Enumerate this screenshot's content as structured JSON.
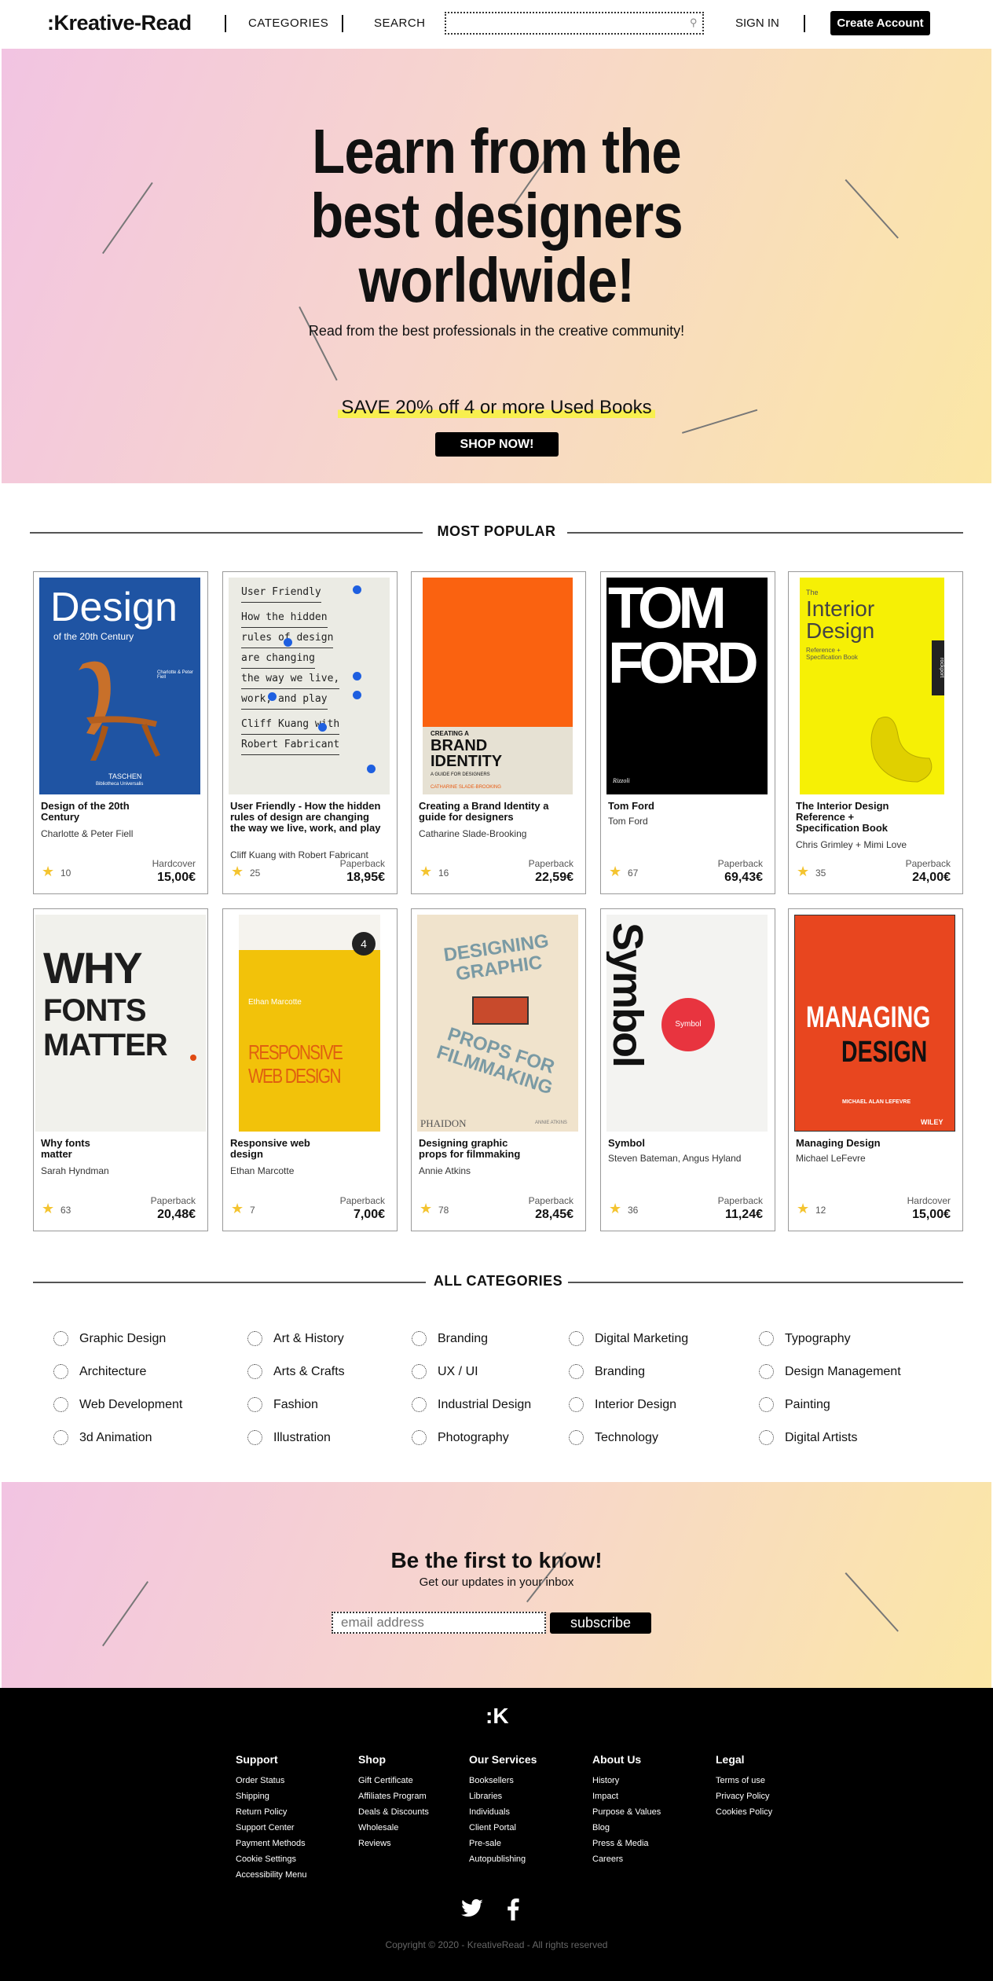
{
  "header": {
    "logo": ":Kreative-Read",
    "nav": [
      "CATEGORIES",
      "SEARCH"
    ],
    "search_placeholder": "",
    "signin": "SIGN IN",
    "create": "Create Account"
  },
  "hero": {
    "title_lines": [
      "Learn from the",
      "best designers",
      "worldwide!"
    ],
    "subtitle": "Read from the best professionals in the creative community!",
    "offer": "SAVE 20% off 4 or more Used Books",
    "cta": "SHOP NOW!"
  },
  "popular": {
    "heading": "MOST POPULAR",
    "books": [
      {
        "title": "Design of the 20th Century",
        "author": "Charlotte & Peter Fiell",
        "rating": "10",
        "format": "Hardcover",
        "price": "15,00€",
        "cover_title": "Design",
        "cover_sub": "of the 20th Century",
        "cover_pub": "TASCHEN",
        "cover_pub2": "Bibliotheca Universalis",
        "cover_authors": "Charlotte & Peter Fiell"
      },
      {
        "title": "User Friendly - How the hidden rules of design are changing the way we live, work, and play",
        "author": "Cliff Kuang with Robert Fabricant",
        "rating": "25",
        "format": "Paperback",
        "price": "18,95€",
        "cover_lines": [
          "User Friendly",
          "How the hidden",
          "rules of design",
          "are changing",
          "the way we live,",
          "work, and play",
          "Cliff Kuang with",
          "Robert Fabricant"
        ]
      },
      {
        "title": "Creating a Brand Identity a guide for designers",
        "author": "Catharine Slade-Brooking",
        "rating": "16",
        "format": "Paperback",
        "price": "22,59€",
        "cover_small": "CREATING A",
        "cover_big": "BRAND IDENTITY",
        "cover_sub": "A GUIDE FOR DESIGNERS",
        "cover_author": "CATHARINE SLADE-BROOKING"
      },
      {
        "title": "Tom Ford",
        "author": "Tom Ford",
        "rating": "67",
        "format": "Paperback",
        "price": "69,43€",
        "cover_lines": [
          "TOM",
          "FORD"
        ],
        "cover_pub": "Rizzoli"
      },
      {
        "title": "The Interior Design Reference + Specification Book",
        "author": "Chris Grimley + Mimi Love",
        "rating": "35",
        "format": "Paperback",
        "price": "24,00€",
        "cover_small": "The",
        "cover_big": "Interior Design",
        "cover_sub": "Reference + Specification Book",
        "cover_side": "rockport"
      },
      {
        "title": "Why fonts matter",
        "author": "Sarah Hyndman",
        "rating": "63",
        "format": "Paperback",
        "price": "20,48€",
        "cover_lines": [
          "WHY",
          "FONTS",
          "MATTER"
        ]
      },
      {
        "title": "Responsive web design",
        "author": "Ethan Marcotte",
        "rating": "7",
        "format": "Paperback",
        "price": "7,00€",
        "cover_badge": "4",
        "cover_author": "Ethan Marcotte",
        "cover_lines": [
          "RESPONSIVE",
          "WEB DESIGN"
        ]
      },
      {
        "title": "Designing graphic props for filmmaking",
        "author": "Annie Atkins",
        "rating": "78",
        "format": "Paperback",
        "price": "28,45€",
        "cover_top": "DESIGNING GRAPHIC",
        "cover_bottom": "PROPS FOR FILMMAKING",
        "cover_pub": "PHAIDON",
        "cover_author": "ANNIE ATKINS"
      },
      {
        "title": "Symbol",
        "author": "Steven Bateman, Angus Hyland",
        "rating": "36",
        "format": "Paperback",
        "price": "11,24€",
        "cover_big": "Symbol",
        "cover_circle": "Symbol"
      },
      {
        "title": "Managing Design",
        "author": "Michael LeFevre",
        "rating": "12",
        "format": "Hardcover",
        "price": "15,00€",
        "cover_lines": [
          "MANAGING",
          "DESIGN"
        ],
        "cover_author": "MICHAEL ALAN LEFEVRE",
        "cover_pub": "WILEY"
      }
    ]
  },
  "categories": {
    "heading": "ALL CATEGORIES",
    "items": [
      "Graphic Design",
      "Art & History",
      "Branding",
      "Digital Marketing",
      "Typography",
      "Architecture",
      "Arts & Crafts",
      "UX / UI",
      "Branding",
      "Design Management",
      "Web Development",
      "Fashion",
      "Industrial Design",
      "Interior Design",
      "Painting",
      "3d Animation",
      "Illustration",
      "Photography",
      "Technology",
      "Digital Artists"
    ]
  },
  "newsletter": {
    "title": "Be the first to know!",
    "subtitle": "Get our updates in your inbox",
    "placeholder": "email address",
    "button": "subscribe"
  },
  "footer": {
    "logo": ":K",
    "columns": [
      {
        "title": "Support",
        "links": [
          "Order Status",
          "Shipping",
          "Return Policy",
          "Support Center",
          "Payment Methods",
          "Cookie Settings",
          "Accessibility Menu"
        ]
      },
      {
        "title": "Shop",
        "links": [
          "Gift Certificate",
          "Affiliates Program",
          "Deals & Discounts",
          "Wholesale",
          "Reviews"
        ]
      },
      {
        "title": "Our Services",
        "links": [
          "Booksellers",
          "Libraries",
          "Individuals",
          "Client Portal",
          "Pre-sale",
          "Autopublishing"
        ]
      },
      {
        "title": "About Us",
        "links": [
          "History",
          "Impact",
          "Purpose & Values",
          "Blog",
          "Press & Media",
          "Careers"
        ]
      },
      {
        "title": "Legal",
        "links": [
          "Terms of use",
          "Privacy Policy",
          "Cookies Policy"
        ]
      }
    ],
    "social": [
      "twitter-icon",
      "facebook-icon"
    ],
    "copyright": "Copyright © 2020  -  KreativeRead  -  All rights reserved"
  },
  "colors": {
    "accent": "#000000",
    "star": "#f4c430",
    "highlight": "#f8ef4f"
  }
}
